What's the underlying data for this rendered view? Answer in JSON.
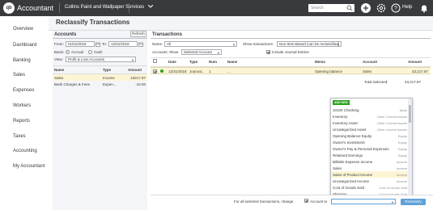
{
  "app": {
    "brand": "Accountant",
    "logo": "qb",
    "company": "Collins Paint and Wallpaper Services",
    "search_placeholder": "Search",
    "help": "Help"
  },
  "nav": [
    "Overview",
    "Dashboard",
    "Banking",
    "Sales",
    "Expenses",
    "Workers",
    "Reports",
    "Taxes",
    "Accounting",
    "My Accountant"
  ],
  "page": {
    "title": "Reclassify Transactions"
  },
  "accounts_panel": {
    "title": "Accounts",
    "refresh": "Refresh",
    "from_label": "From:",
    "from_value": "01/01/2018",
    "to_label": "To:",
    "to_value": "12/31/2018",
    "basis_label": "Basis:",
    "basis_accrual": "Accrual",
    "basis_cash": "Cash",
    "view_label": "View:",
    "view_value": "Profit & Loss Accounts",
    "columns": [
      "Name",
      "Type",
      "Amount"
    ],
    "rows": [
      {
        "name": "Sales",
        "type": "Income",
        "amount": "43217.87"
      },
      {
        "name": "Bank Charges & Fees",
        "type": "Expen...",
        "amount": "-10.00"
      }
    ]
  },
  "transactions_panel": {
    "title": "Transactions",
    "name_label": "Name:",
    "name_value": "All",
    "show_label": "Show transactions:",
    "show_value": "Non-Item-Based (can be reclassified)",
    "accounts_label": "Accounts: Show",
    "accounts_value": "Selected Account",
    "include_journal": "Include Journal Entries",
    "columns": [
      "Date",
      "Type",
      "Num",
      "Name",
      "Memo",
      "Account",
      "Amount"
    ],
    "row": {
      "date": "12/31/2018",
      "type": "Journal...",
      "num": "1",
      "name": "...",
      "memo": "Opening balance",
      "account": "Sales",
      "amount": "43,217.87"
    },
    "total_label": "Total Selected:",
    "total_value": "43,217.87"
  },
  "dropdown": {
    "add_new": "ADD NEW",
    "items": [
      {
        "name": "10100 Checking",
        "type": "Bank"
      },
      {
        "name": "Inventory",
        "type": "Other Current Assets"
      },
      {
        "name": "Inventory Asset",
        "type": "Other Current Assets"
      },
      {
        "name": "Uncategorized Asset",
        "type": "Other Current Assets"
      },
      {
        "name": "Opening Balance Equity",
        "type": "Equity"
      },
      {
        "name": "Owner's Investment",
        "type": "Equity"
      },
      {
        "name": "Owner's Pay & Personal Expenses",
        "type": "Equity"
      },
      {
        "name": "Retained Earnings",
        "type": "Equity"
      },
      {
        "name": "Billable Expense Income",
        "type": "Income"
      },
      {
        "name": "Sales",
        "type": "Income"
      },
      {
        "name": "Sales of Product Income",
        "type": "Income"
      },
      {
        "name": "Uncategorized Income",
        "type": "Income"
      },
      {
        "name": "Cost of Goods Sold",
        "type": "Cost of Goods Sold"
      },
      {
        "name": "Shipping",
        "type": "Cost of Goods Sold"
      }
    ],
    "selected_index": 10
  },
  "bottom": {
    "change_label": "For all selected transactions, change",
    "account_to": "Account to",
    "apply": "Reclassify"
  },
  "colors": {
    "topbar": "#393a3d",
    "accent_green": "#2ca01c",
    "selected_row": "#fcf5d4",
    "apply_button": "#5fa1d8"
  }
}
